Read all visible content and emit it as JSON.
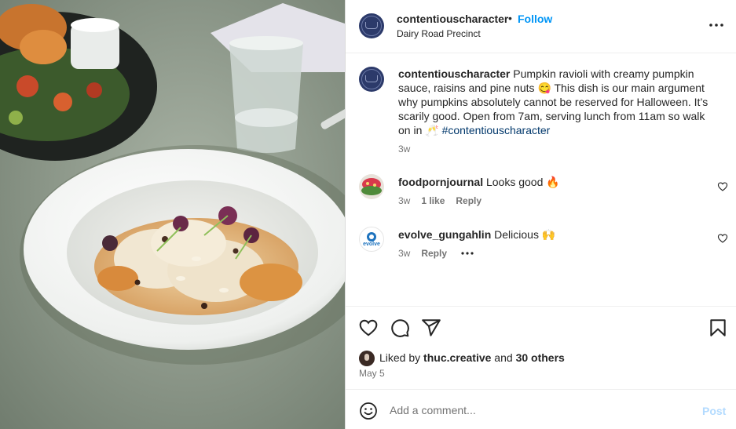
{
  "header": {
    "username": "contentiouscharacter",
    "separator": "•",
    "follow_label": "Follow",
    "location": "Dairy Road Precinct"
  },
  "caption": {
    "username": "contentiouscharacter",
    "text": " Pumpkin ravioli with creamy pumpkin sauce, raisins and pine nuts 😋 This dish is our main argument why pumpkins absolutely cannot be reserved for Halloween. It’s scarily good. Open from 7am, serving lunch from 11am so walk on in 🥂 ",
    "hashtag": "#contentiouscharacter",
    "time": "3w"
  },
  "comments": [
    {
      "username": "foodpornjournal",
      "text": " Looks good 🔥",
      "time": "3w",
      "likes": "1 like",
      "reply": "Reply"
    },
    {
      "username": "evolve_gungahlin",
      "text": " Delicious 🙌",
      "time": "3w",
      "reply": "Reply",
      "avatar_text": "evolve"
    }
  ],
  "likes": {
    "prefix": "Liked by ",
    "user": "thuc.creative",
    "middle": " and ",
    "others": "30 others"
  },
  "date": "May 5",
  "add_comment": {
    "placeholder": "Add a comment...",
    "post_label": "Post"
  },
  "icons": {
    "more": "more-horizontal-icon",
    "like": "heart-icon",
    "comment": "comment-icon",
    "share": "share-icon",
    "save": "bookmark-icon",
    "emoji": "emoji-icon"
  },
  "colors": {
    "link_blue": "#0095f6",
    "hashtag": "#00376b",
    "post_disabled": "#b3dbff",
    "muted": "#737373"
  }
}
